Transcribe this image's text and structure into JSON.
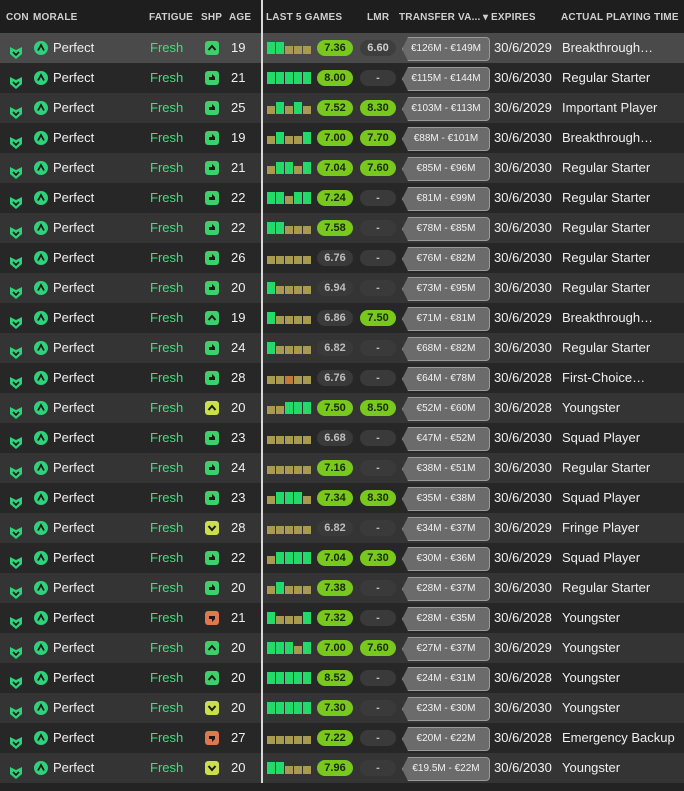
{
  "colors": {
    "fresh_green": "#3ee07f",
    "rating_green": "#78c81e",
    "shp_up": "#3ecf6a",
    "shp_down": "#e0784e",
    "shp_yellow": "#c9e04a",
    "bar_green": "#22d96a",
    "bar_gold": "#a89a4e",
    "bar_orange": "#c27a3a"
  },
  "headers": {
    "con": "CON",
    "morale": "MORALE",
    "fatigue": "FATIGUE",
    "shp": "SHP",
    "age": "AGE",
    "last5": "LAST 5 GAMES",
    "lmr": "LMR",
    "transfer": "TRANSFER VA...",
    "expires": "EXPIRES",
    "apt": "ACTUAL PLAYING TIME"
  },
  "rows": [
    {
      "morale": "Perfect",
      "fatigue": "Fresh",
      "shp": "up",
      "age": "19",
      "bars": [
        "g",
        "g",
        "o",
        "o",
        "o"
      ],
      "rating": "7.36",
      "rating_level": "good",
      "lmr": "6.60",
      "lmr_level": "mid",
      "value": "€126M - €149M",
      "expires": "30/6/2029",
      "apt": "Breakthrough…"
    },
    {
      "morale": "Perfect",
      "fatigue": "Fresh",
      "shp": "thumb",
      "age": "21",
      "bars": [
        "g",
        "g",
        "g",
        "g",
        "g"
      ],
      "rating": "8.00",
      "rating_level": "good",
      "lmr": "-",
      "lmr_level": "none",
      "value": "€115M - €144M",
      "expires": "30/6/2030",
      "apt": "Regular Starter"
    },
    {
      "morale": "Perfect",
      "fatigue": "Fresh",
      "shp": "thumb",
      "age": "25",
      "bars": [
        "o",
        "g",
        "o",
        "g",
        "o"
      ],
      "rating": "7.52",
      "rating_level": "good",
      "lmr": "8.30",
      "lmr_level": "good",
      "value": "€103M - €113M",
      "expires": "30/6/2029",
      "apt": "Important Player"
    },
    {
      "morale": "Perfect",
      "fatigue": "Fresh",
      "shp": "thumb",
      "age": "19",
      "bars": [
        "o",
        "g",
        "o",
        "o",
        "g"
      ],
      "rating": "7.00",
      "rating_level": "good",
      "lmr": "7.70",
      "lmr_level": "good",
      "value": "€88M - €101M",
      "expires": "30/6/2030",
      "apt": "Breakthrough…"
    },
    {
      "morale": "Perfect",
      "fatigue": "Fresh",
      "shp": "thumb",
      "age": "21",
      "bars": [
        "o",
        "g",
        "g",
        "o",
        "g"
      ],
      "rating": "7.04",
      "rating_level": "good",
      "lmr": "7.60",
      "lmr_level": "good",
      "value": "€85M - €96M",
      "expires": "30/6/2030",
      "apt": "Regular Starter"
    },
    {
      "morale": "Perfect",
      "fatigue": "Fresh",
      "shp": "thumb",
      "age": "22",
      "bars": [
        "g",
        "g",
        "o",
        "g",
        "g"
      ],
      "rating": "7.24",
      "rating_level": "good",
      "lmr": "-",
      "lmr_level": "none",
      "value": "€81M - €99M",
      "expires": "30/6/2030",
      "apt": "Regular Starter"
    },
    {
      "morale": "Perfect",
      "fatigue": "Fresh",
      "shp": "thumb",
      "age": "22",
      "bars": [
        "g",
        "g",
        "o",
        "o",
        "o"
      ],
      "rating": "7.58",
      "rating_level": "good",
      "lmr": "-",
      "lmr_level": "none",
      "value": "€78M - €85M",
      "expires": "30/6/2030",
      "apt": "Regular Starter"
    },
    {
      "morale": "Perfect",
      "fatigue": "Fresh",
      "shp": "thumb",
      "age": "26",
      "bars": [
        "o",
        "o",
        "o",
        "o",
        "o"
      ],
      "rating": "6.76",
      "rating_level": "mid",
      "lmr": "-",
      "lmr_level": "none",
      "value": "€76M - €82M",
      "expires": "30/6/2030",
      "apt": "Regular Starter"
    },
    {
      "morale": "Perfect",
      "fatigue": "Fresh",
      "shp": "thumb",
      "age": "20",
      "bars": [
        "g",
        "o",
        "o",
        "o",
        "o"
      ],
      "rating": "6.94",
      "rating_level": "mid",
      "lmr": "-",
      "lmr_level": "none",
      "value": "€73M - €95M",
      "expires": "30/6/2030",
      "apt": "Regular Starter"
    },
    {
      "morale": "Perfect",
      "fatigue": "Fresh",
      "shp": "up",
      "age": "19",
      "bars": [
        "g",
        "o",
        "o",
        "o",
        "o"
      ],
      "rating": "6.86",
      "rating_level": "mid",
      "lmr": "7.50",
      "lmr_level": "good",
      "value": "€71M - €81M",
      "expires": "30/6/2029",
      "apt": "Breakthrough…"
    },
    {
      "morale": "Perfect",
      "fatigue": "Fresh",
      "shp": "thumb",
      "age": "24",
      "bars": [
        "g",
        "o",
        "o",
        "o",
        "o"
      ],
      "rating": "6.82",
      "rating_level": "mid",
      "lmr": "-",
      "lmr_level": "none",
      "value": "€68M - €82M",
      "expires": "30/6/2030",
      "apt": "Regular Starter"
    },
    {
      "morale": "Perfect",
      "fatigue": "Fresh",
      "shp": "thumb",
      "age": "28",
      "bars": [
        "o",
        "o",
        "r",
        "o",
        "o"
      ],
      "rating": "6.76",
      "rating_level": "mid",
      "lmr": "-",
      "lmr_level": "none",
      "value": "€64M - €78M",
      "expires": "30/6/2028",
      "apt": "First-Choice…"
    },
    {
      "morale": "Perfect",
      "fatigue": "Fresh",
      "shp": "yup",
      "age": "20",
      "bars": [
        "o",
        "o",
        "g",
        "g",
        "g"
      ],
      "rating": "7.50",
      "rating_level": "good",
      "lmr": "8.50",
      "lmr_level": "good",
      "value": "€52M - €60M",
      "expires": "30/6/2028",
      "apt": "Youngster"
    },
    {
      "morale": "Perfect",
      "fatigue": "Fresh",
      "shp": "thumb",
      "age": "23",
      "bars": [
        "o",
        "o",
        "o",
        "o",
        "o"
      ],
      "rating": "6.68",
      "rating_level": "mid",
      "lmr": "-",
      "lmr_level": "none",
      "value": "€47M - €52M",
      "expires": "30/6/2030",
      "apt": "Squad Player"
    },
    {
      "morale": "Perfect",
      "fatigue": "Fresh",
      "shp": "thumb",
      "age": "24",
      "bars": [
        "o",
        "o",
        "o",
        "o",
        "o"
      ],
      "rating": "7.16",
      "rating_level": "good",
      "lmr": "-",
      "lmr_level": "none",
      "value": "€38M - €51M",
      "expires": "30/6/2030",
      "apt": "Regular Starter"
    },
    {
      "morale": "Perfect",
      "fatigue": "Fresh",
      "shp": "thumb",
      "age": "23",
      "bars": [
        "o",
        "g",
        "g",
        "g",
        "o"
      ],
      "rating": "7.34",
      "rating_level": "good",
      "lmr": "8.30",
      "lmr_level": "good",
      "value": "€35M - €38M",
      "expires": "30/6/2030",
      "apt": "Squad Player"
    },
    {
      "morale": "Perfect",
      "fatigue": "Fresh",
      "shp": "ydown",
      "age": "28",
      "bars": [
        "o",
        "o",
        "o",
        "o",
        "o"
      ],
      "rating": "6.82",
      "rating_level": "mid",
      "lmr": "-",
      "lmr_level": "none",
      "value": "€34M - €37M",
      "expires": "30/6/2029",
      "apt": "Fringe Player"
    },
    {
      "morale": "Perfect",
      "fatigue": "Fresh",
      "shp": "thumb",
      "age": "22",
      "bars": [
        "o",
        "g",
        "g",
        "g",
        "g"
      ],
      "rating": "7.04",
      "rating_level": "good",
      "lmr": "7.30",
      "lmr_level": "good",
      "value": "€30M - €36M",
      "expires": "30/6/2029",
      "apt": "Squad Player"
    },
    {
      "morale": "Perfect",
      "fatigue": "Fresh",
      "shp": "thumb",
      "age": "20",
      "bars": [
        "o",
        "g",
        "o",
        "o",
        "o"
      ],
      "rating": "7.38",
      "rating_level": "good",
      "lmr": "-",
      "lmr_level": "none",
      "value": "€28M - €37M",
      "expires": "30/6/2030",
      "apt": "Regular Starter"
    },
    {
      "morale": "Perfect",
      "fatigue": "Fresh",
      "shp": "down",
      "age": "21",
      "bars": [
        "g",
        "o",
        "o",
        "o",
        "g"
      ],
      "rating": "7.32",
      "rating_level": "good",
      "lmr": "-",
      "lmr_level": "none",
      "value": "€28M - €35M",
      "expires": "30/6/2028",
      "apt": "Youngster"
    },
    {
      "morale": "Perfect",
      "fatigue": "Fresh",
      "shp": "up",
      "age": "20",
      "bars": [
        "g",
        "g",
        "g",
        "o",
        "g"
      ],
      "rating": "7.00",
      "rating_level": "good",
      "lmr": "7.60",
      "lmr_level": "good",
      "value": "€27M - €37M",
      "expires": "30/6/2029",
      "apt": "Youngster"
    },
    {
      "morale": "Perfect",
      "fatigue": "Fresh",
      "shp": "up",
      "age": "20",
      "bars": [
        "g",
        "g",
        "g",
        "g",
        "g"
      ],
      "rating": "8.52",
      "rating_level": "good",
      "lmr": "-",
      "lmr_level": "none",
      "value": "€24M - €31M",
      "expires": "30/6/2028",
      "apt": "Youngster"
    },
    {
      "morale": "Perfect",
      "fatigue": "Fresh",
      "shp": "ydown",
      "age": "20",
      "bars": [
        "g",
        "g",
        "g",
        "g",
        "g"
      ],
      "rating": "7.30",
      "rating_level": "good",
      "lmr": "-",
      "lmr_level": "none",
      "value": "€23M - €30M",
      "expires": "30/6/2030",
      "apt": "Youngster"
    },
    {
      "morale": "Perfect",
      "fatigue": "Fresh",
      "shp": "down",
      "age": "27",
      "bars": [
        "o",
        "o",
        "o",
        "o",
        "o"
      ],
      "rating": "7.22",
      "rating_level": "good",
      "lmr": "-",
      "lmr_level": "none",
      "value": "€20M - €22M",
      "expires": "30/6/2028",
      "apt": "Emergency Backup"
    },
    {
      "morale": "Perfect",
      "fatigue": "Fresh",
      "shp": "ydown",
      "age": "20",
      "bars": [
        "g",
        "g",
        "o",
        "o",
        "o"
      ],
      "rating": "7.96",
      "rating_level": "good",
      "lmr": "-",
      "lmr_level": "none",
      "value": "€19.5M - €22M",
      "expires": "30/6/2030",
      "apt": "Youngster"
    }
  ]
}
